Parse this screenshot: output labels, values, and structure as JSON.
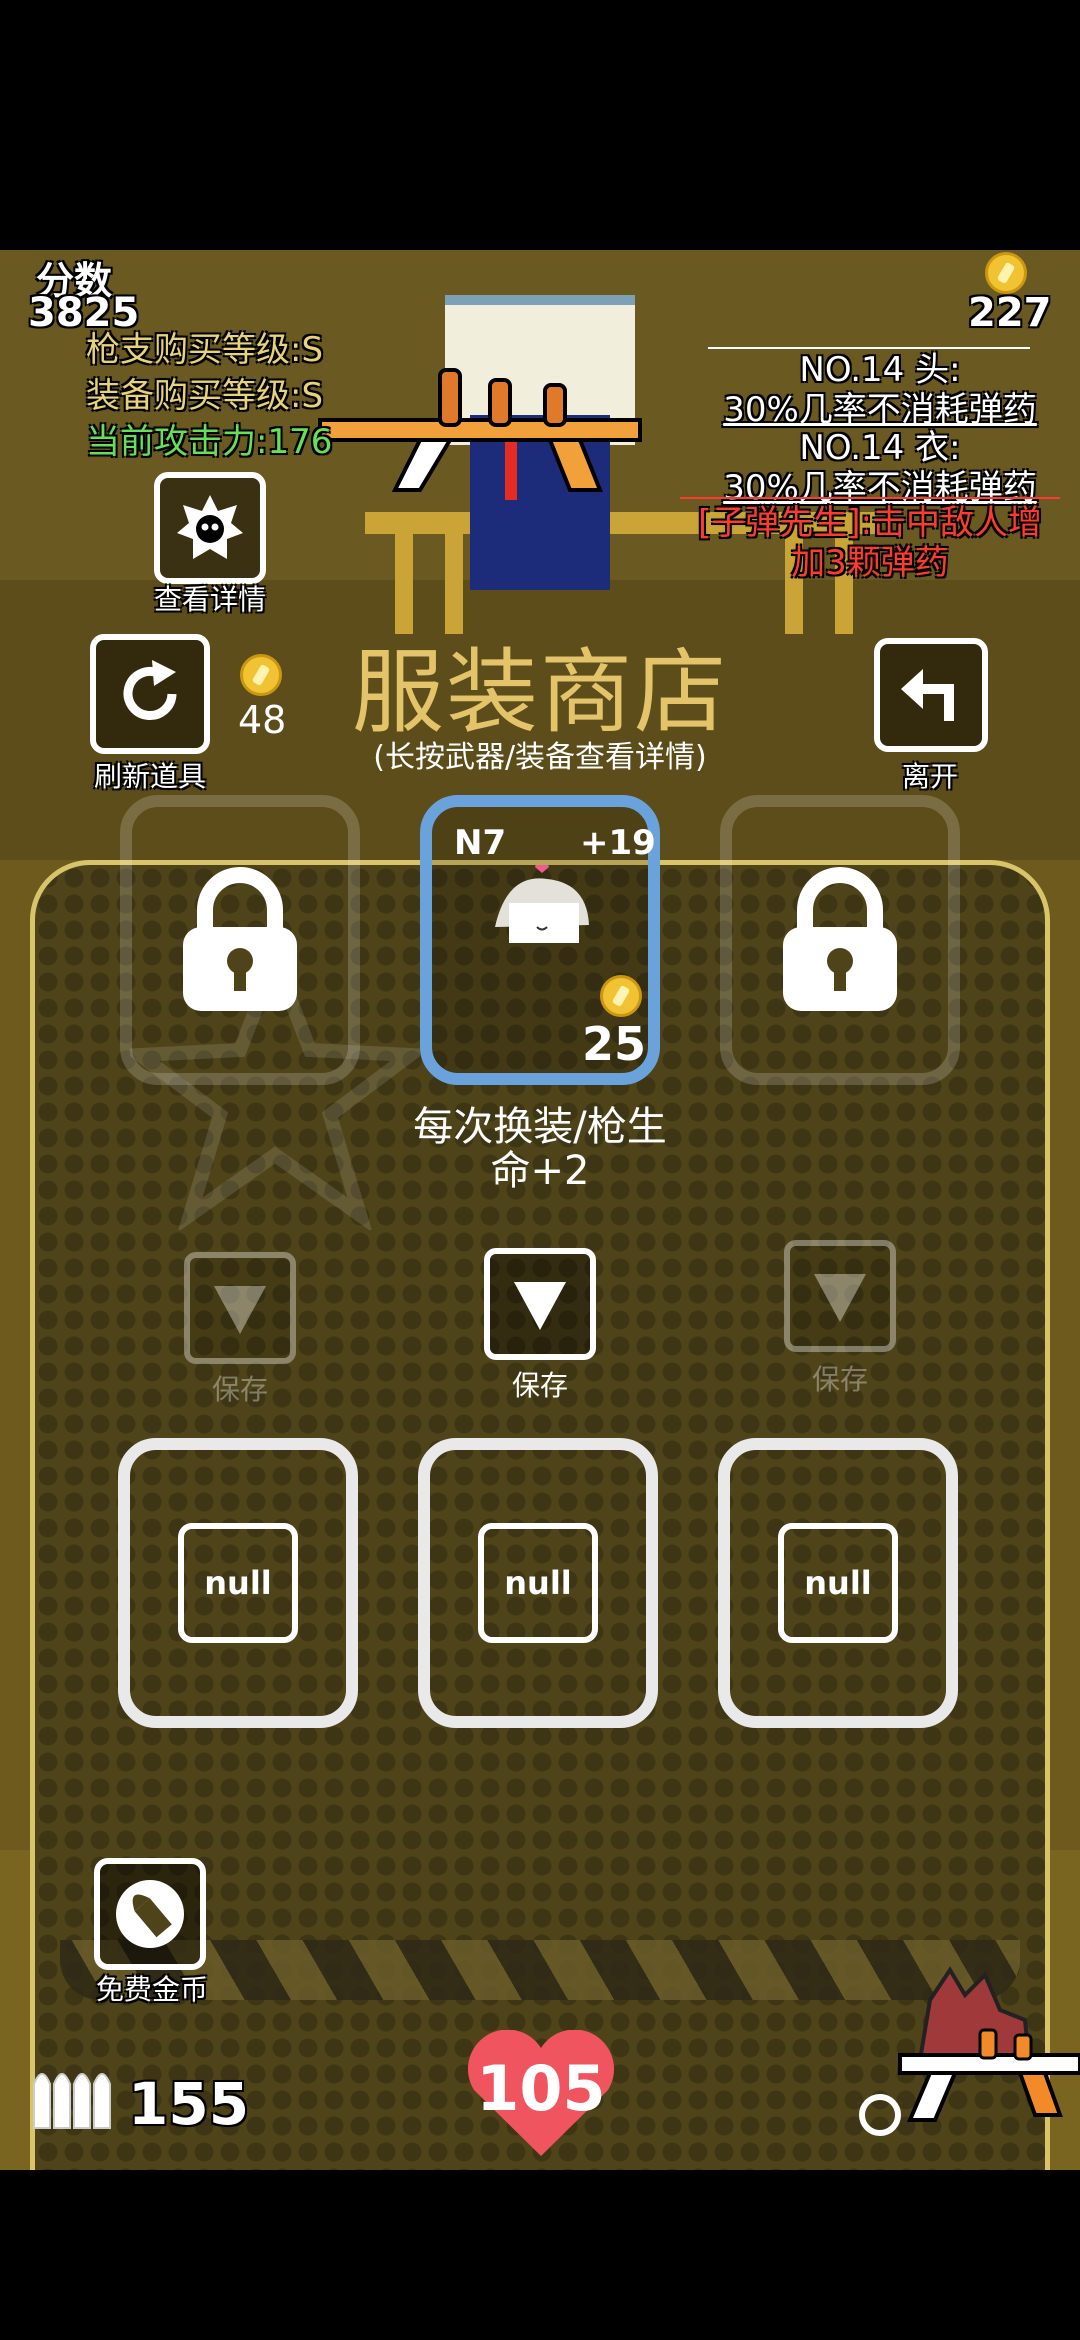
{
  "hud": {
    "score_label": "分数",
    "score_value": "3825",
    "gun_level": "枪支购买等级:S",
    "equip_level": "装备购买等级:S",
    "attack_power": "当前攻击力:176",
    "coins": "227",
    "detail_label": "查看详情"
  },
  "effects": [
    {
      "title": "NO.14 头:",
      "desc": "30%几率不消耗弹药"
    },
    {
      "title": "NO.14 衣:",
      "desc": "30%几率不消耗弹药"
    }
  ],
  "bonus_line1": "[子弹先生]:击中敌人增",
  "bonus_line2": "加3颗弹药",
  "shop": {
    "title": "服装商店",
    "subtitle": "(长按武器/装备查看详情)",
    "refresh_label": "刷新道具",
    "refresh_cost": "48",
    "exit_label": "离开",
    "item": {
      "id": "N7",
      "bonus": "+19",
      "price": "25",
      "desc_line1": "每次换装/枪生",
      "desc_line2": "命+2"
    },
    "save_label": "保存",
    "null_label": "null",
    "free_coins_label": "免费金币"
  },
  "status": {
    "ammo": "155",
    "health": "105"
  },
  "colors": {
    "attack_green": "#66e05a",
    "level_gold": "#e8d27a",
    "bonus_red": "#ff3b2f",
    "title_gold": "#e3c46a",
    "heart": "#f0545e",
    "active_blue": "#6aa3dc"
  }
}
